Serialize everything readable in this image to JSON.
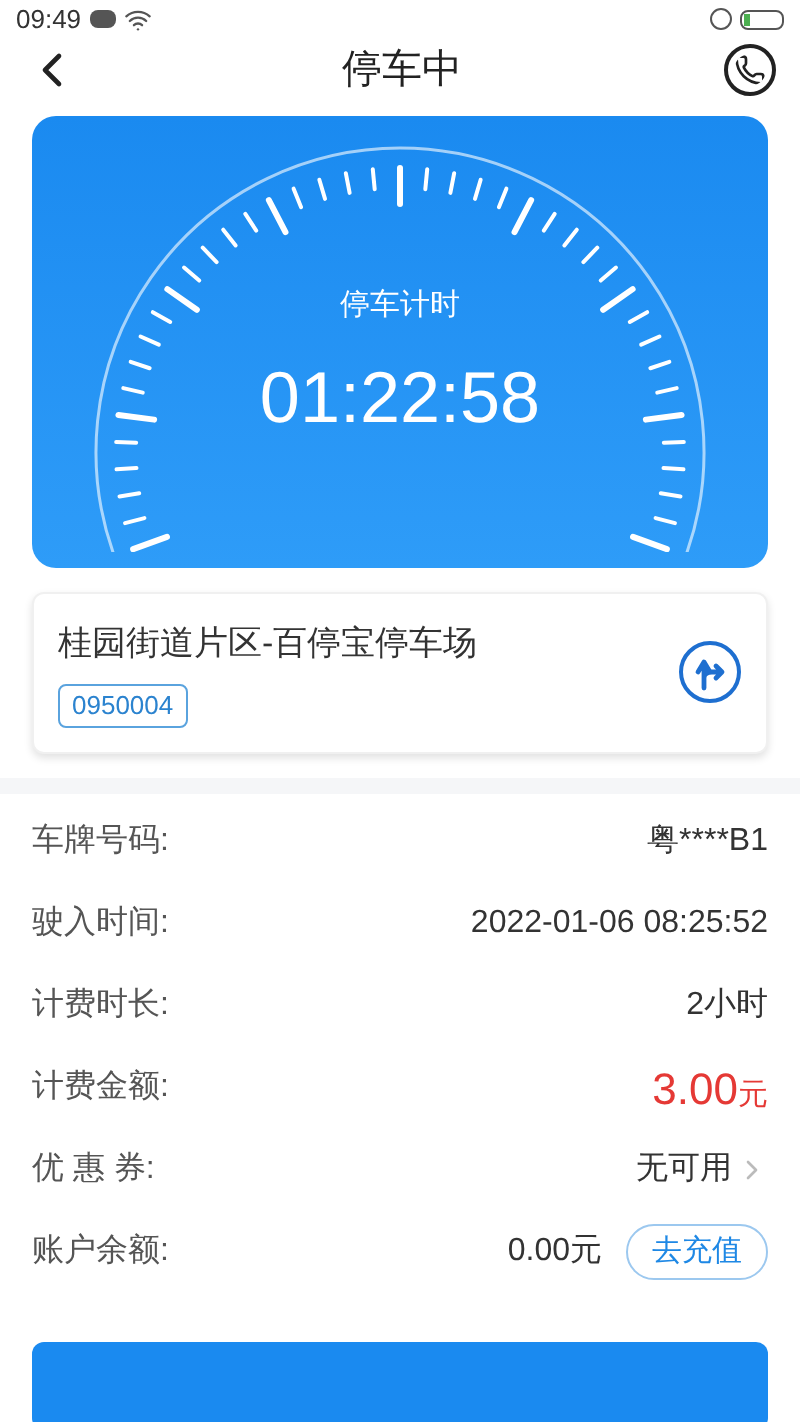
{
  "status_bar": {
    "time": "09:49"
  },
  "header": {
    "title": "停车中"
  },
  "timer": {
    "label": "停车计时",
    "value": "01:22:58"
  },
  "lot": {
    "name": "桂园街道片区-百停宝停车场",
    "code": "0950004"
  },
  "details": [
    {
      "kind": "text",
      "label": "车牌号码:",
      "value": "粤****B1"
    },
    {
      "kind": "text",
      "label": "驶入时间:",
      "value": "2022-01-06 08:25:52"
    },
    {
      "kind": "text",
      "label": "计费时长:",
      "value": "2小时"
    },
    {
      "kind": "amount",
      "label": "计费金额:",
      "value": "3.00",
      "unit": "元"
    },
    {
      "kind": "link",
      "label": "优 惠 券:",
      "value": "无可用"
    },
    {
      "kind": "balance",
      "label": "账户余额:",
      "value": "0.00元",
      "action": "去充值"
    }
  ]
}
